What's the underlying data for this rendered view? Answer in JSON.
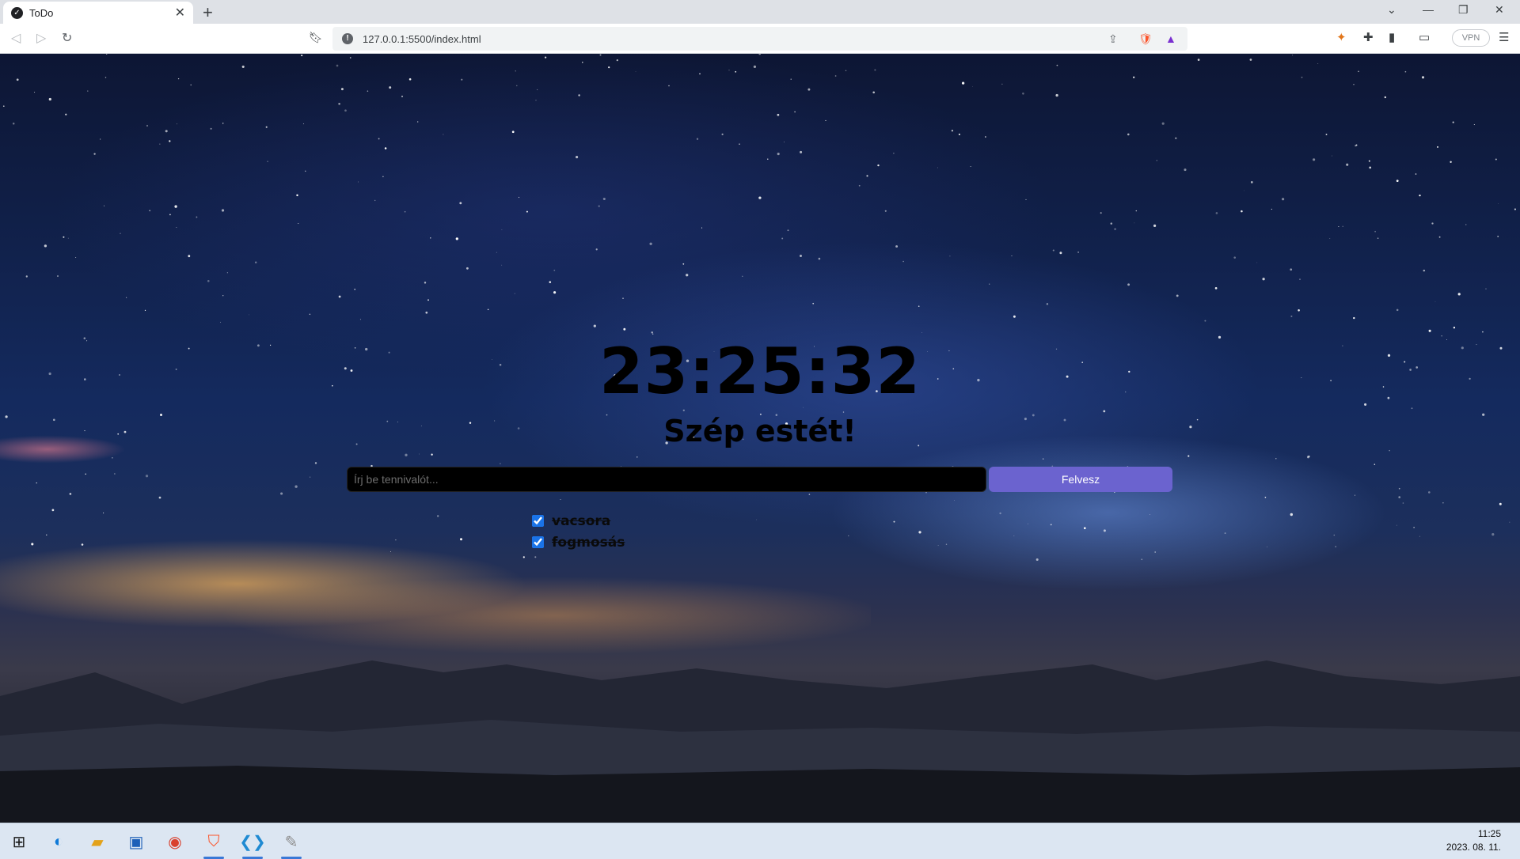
{
  "browser": {
    "tab_title": "ToDo",
    "tab_close": "✕",
    "new_tab": "+",
    "url": "127.0.0.1:5500/index.html",
    "vpn_label": "VPN",
    "window_controls": [
      "⌄",
      "—",
      "❐",
      "✕"
    ]
  },
  "page": {
    "clock": "23:25:32",
    "greeting": "Szép estét!",
    "input_placeholder": "Írj be tennivalót...",
    "input_value": "",
    "add_button_label": "Felvesz",
    "todos": [
      {
        "text": "vacsora",
        "done": true
      },
      {
        "text": "fogmosás",
        "done": true
      }
    ],
    "accent_color": "#6b63cf"
  },
  "taskbar": {
    "apps": [
      "windows-start-icon",
      "edge-icon",
      "file-explorer-icon",
      "store-icon",
      "chrome-icon",
      "brave-icon",
      "vscode-icon",
      "paint-icon"
    ],
    "time": "11:25",
    "date": "2023. 08. 11."
  }
}
